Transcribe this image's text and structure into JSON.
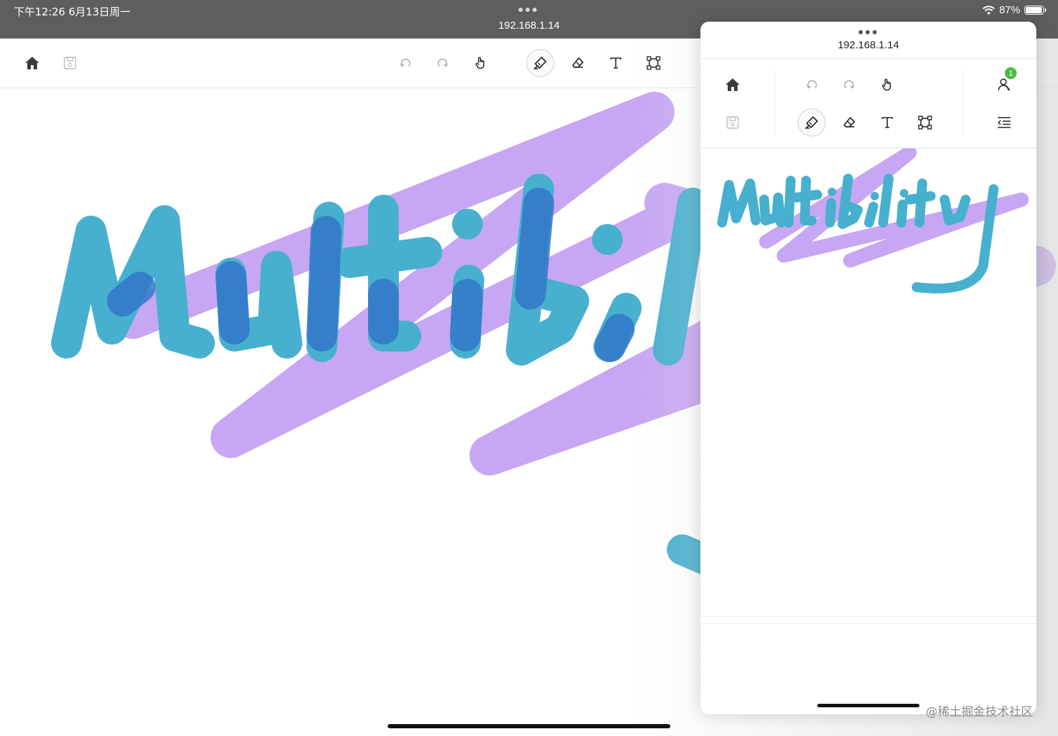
{
  "status_bar": {
    "time_date": "下午12:26   6月13日周一",
    "battery_percent": "87%",
    "battery_level": 0.87,
    "url": "192.168.1.14"
  },
  "main_toolbar": {
    "left_icons": [
      "home-icon",
      "save-icon"
    ],
    "center_icons": [
      "undo-icon",
      "redo-icon",
      "pointer-hand-icon",
      "highlighter-icon",
      "eraser-icon",
      "text-icon",
      "select-frame-icon"
    ],
    "active_tool": "highlighter-icon"
  },
  "panel": {
    "url": "192.168.1.14",
    "collaborator_badge": "1",
    "icons": [
      "home-icon",
      "save-icon",
      "undo-icon",
      "redo-icon",
      "pointer-hand-icon",
      "highlighter-icon",
      "eraser-icon",
      "text-icon",
      "select-frame-icon",
      "users-icon",
      "outdent-menu-icon"
    ],
    "active_tool": "highlighter-icon"
  },
  "drawing": {
    "stroke_colors": {
      "purple_stroke": "#c7a6f4",
      "teal_letters": "#48b0cf",
      "overlap_blue": "#3377c9"
    }
  },
  "watermark": "@稀土掘金技术社区"
}
